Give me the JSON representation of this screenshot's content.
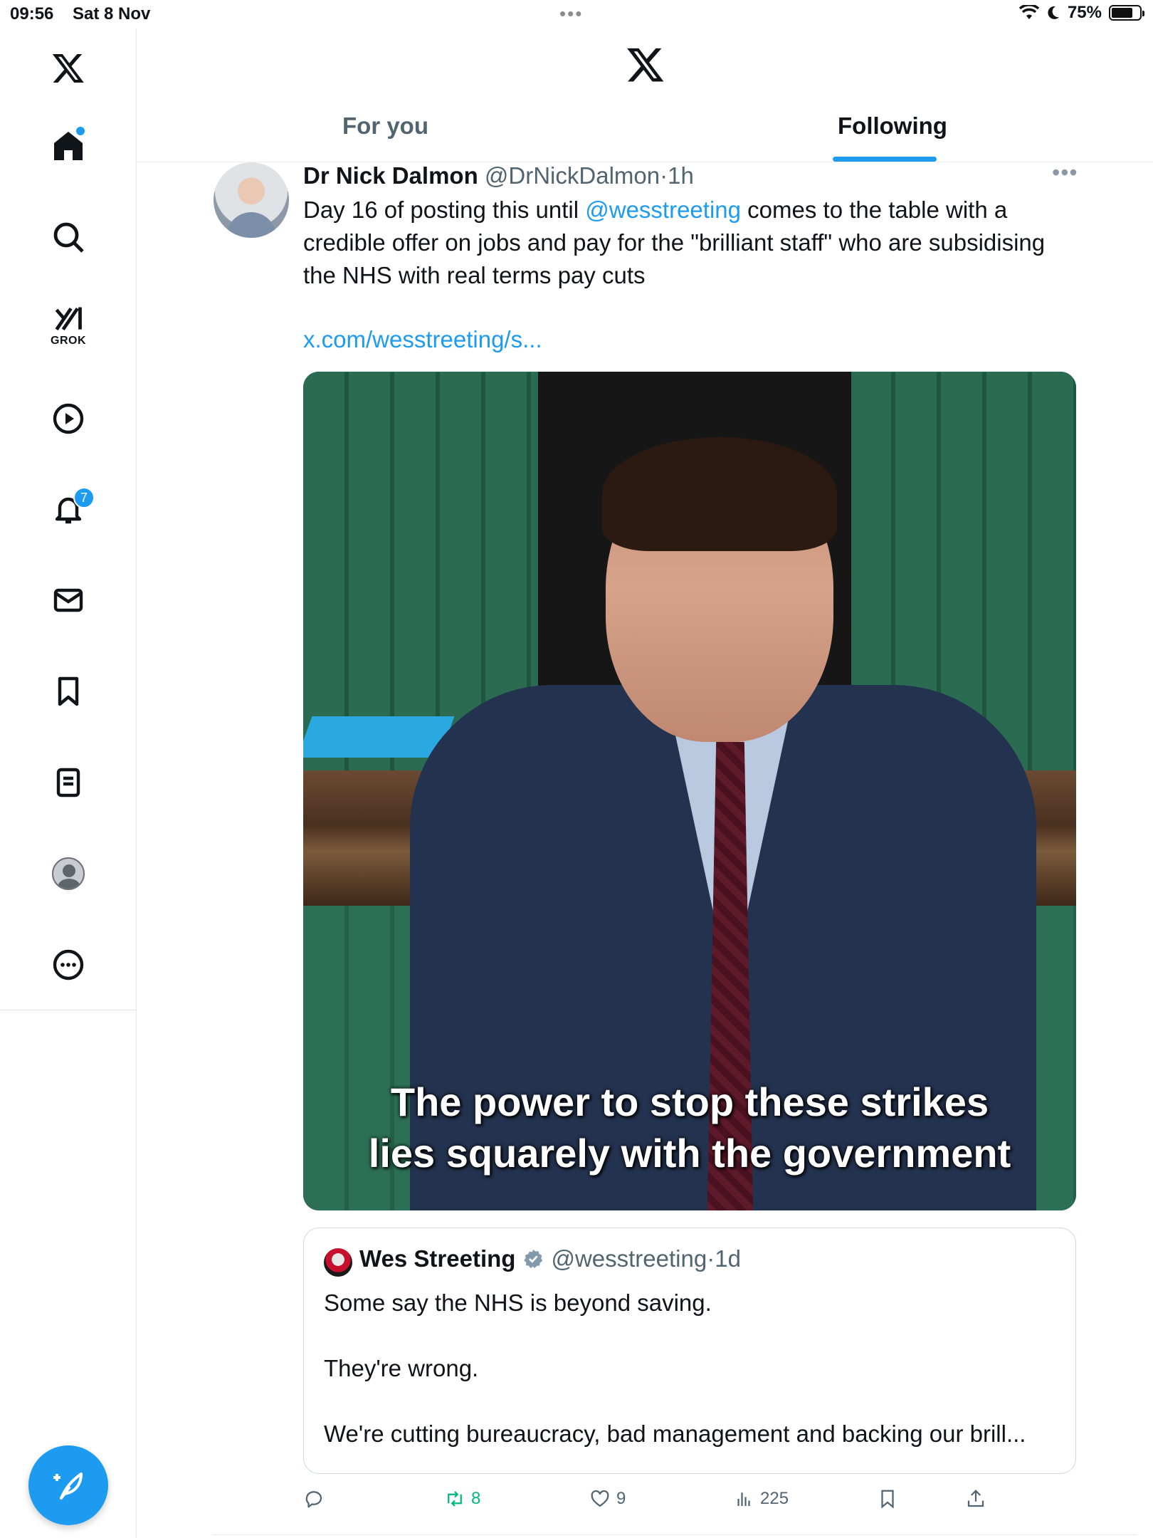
{
  "status_bar": {
    "time": "09:56",
    "date": "Sat 8 Nov",
    "battery": "75%"
  },
  "sidebar": {
    "grok_label": "GROK",
    "notifications_count": "7",
    "items": [
      "home-icon",
      "search-icon",
      "grok-icon",
      "video-icon",
      "bell-icon",
      "mail-icon",
      "bookmark-icon",
      "lists-icon",
      "profile-icon",
      "more-icon"
    ]
  },
  "header": {
    "tabs": [
      {
        "label": "For you",
        "active": false
      },
      {
        "label": "Following",
        "active": true
      }
    ],
    "accent": "#1d9bf0"
  },
  "post": {
    "name": "Dr Nick Dalmon",
    "handle": "@DrNickDalmon",
    "separator": "·",
    "time": "1h",
    "text_before": "Day 16 of posting this until ",
    "mention": "@wesstreeting",
    "text_after": " comes to the table with a credible offer on jobs and pay for the \"brilliant staff\" who are subsidising the NHS with real terms pay cuts",
    "link": "x.com/wesstreeting/s...",
    "media_caption_1": "The power to stop these strikes",
    "media_caption_2": "lies squarely with the government",
    "quote": {
      "name": "Wes Streeting",
      "handle": "@wesstreeting",
      "separator": "·",
      "time": "1d",
      "text": "Some say the NHS is beyond saving.\n\nThey're wrong.\n\nWe're cutting bureaucracy, bad management and backing our brill..."
    },
    "actions": {
      "replies": "",
      "reposts": "8",
      "likes": "9",
      "views": "225"
    }
  }
}
